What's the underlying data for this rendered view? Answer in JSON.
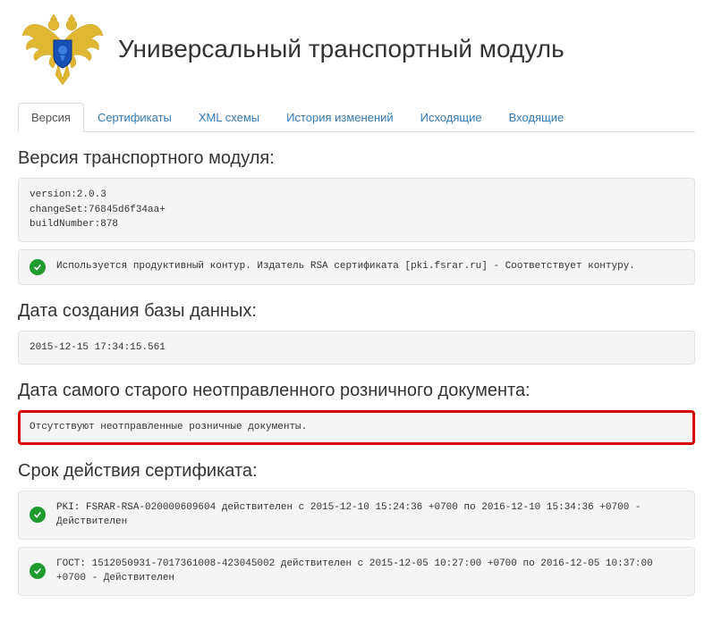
{
  "header": {
    "title": "Универсальный транспортный модуль"
  },
  "tabs": {
    "version": "Версия",
    "certificates": "Сертификаты",
    "xml": "XML схемы",
    "history": "История изменений",
    "outgoing": "Исходящие",
    "incoming": "Входящие"
  },
  "sections": {
    "version_title": "Версия транспортного модуля:",
    "version_block": "version:2.0.3\nchangeSet:76845d6f34aa+\nbuildNumber:878",
    "contour_msg": "Используется продуктивный контур. Издатель RSA сертификата [pki.fsrar.ru] - Соответствует контуру.",
    "db_date_title": "Дата создания базы данных:",
    "db_date_value": "2015-12-15 17:34:15.561",
    "oldest_doc_title": "Дата самого старого неотправленного розничного документа:",
    "oldest_doc_value": "Отсутствуют неотправленные розничные документы.",
    "cert_title": "Срок действия сертификата:",
    "cert_pki": "PKI: FSRAR-RSA-020000609604 действителен с 2015-12-10 15:24:36 +0700 по 2016-12-10 15:34:36 +0700 - Действителен",
    "cert_gost": "ГОСТ: 1512050931-7017361008-423045002 действителен с 2015-12-05 10:27:00 +0700 по 2016-12-05 10:37:00 +0700 - Действителен"
  }
}
